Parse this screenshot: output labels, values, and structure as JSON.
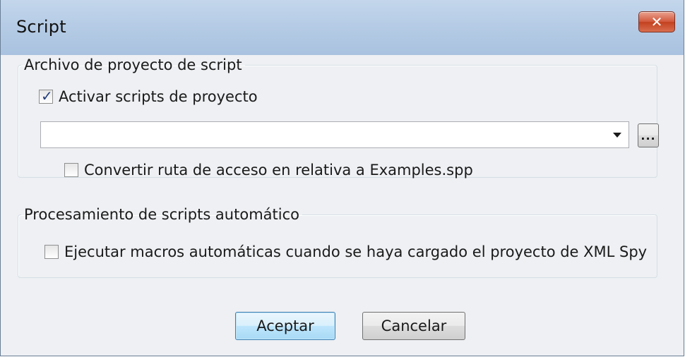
{
  "window": {
    "title": "Script",
    "close_glyph": "✕"
  },
  "project_group": {
    "legend": "Archivo de proyecto de script",
    "enable_checkbox": {
      "label": "Activar scripts de proyecto",
      "checked": true
    },
    "path_combo": {
      "value": ""
    },
    "browse_button": {
      "label": "..."
    },
    "relative_checkbox": {
      "label": "Convertir ruta de acceso en relativa a Examples.spp",
      "checked": false
    }
  },
  "auto_group": {
    "legend": "Procesamiento de scripts automático",
    "run_macros_checkbox": {
      "label": "Ejecutar macros automáticas cuando se haya cargado el proyecto de XML Spy",
      "checked": false
    }
  },
  "buttons": {
    "ok": "Aceptar",
    "cancel": "Cancelar"
  },
  "colors": {
    "titlebar": "#b6cce6",
    "close_button": "#c3411f",
    "default_button_border": "#3c7fb1"
  }
}
